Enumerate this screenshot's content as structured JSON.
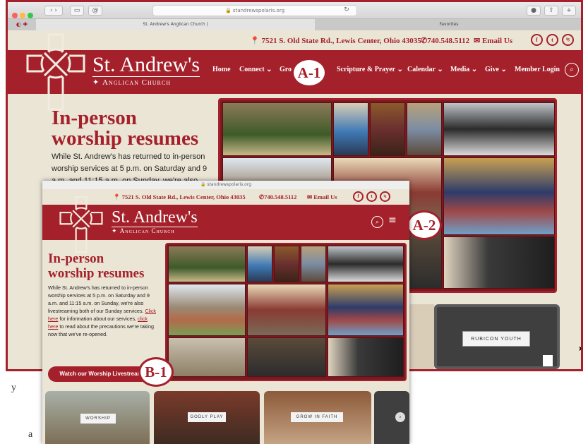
{
  "browser": {
    "url": "standrewspolaris.org",
    "tabs": [
      "St. Andrew's Anglican Church |",
      "Favorites"
    ]
  },
  "topbar": {
    "address": "7521 S. Old State Rd., Lewis Center, Ohio 43035",
    "phone": "740.548.5112",
    "email": "Email Us",
    "social": [
      "f",
      "t",
      "ig"
    ]
  },
  "brand": {
    "name": "St. Andrew's",
    "sub": "Anglican Church"
  },
  "nav": [
    "Home",
    "Connect",
    "Gro",
    "Scripture & Prayer",
    "Calendar",
    "Media",
    "Give",
    "Member Login"
  ],
  "hero": {
    "title_1": "In-person",
    "title_2": "worship resumes",
    "body_desktop_1": "While St. Andrew's has returned to in-person",
    "body_desktop_2": "worship services at 5 p.m. on Saturday and 9",
    "body_desktop_3": "a.m. and 11:15 a.m. on Sunday, we're also"
  },
  "mobile": {
    "url": "standrewspolaris.org",
    "address": "7521 S. Old State Rd., Lewis Center, Ohio 43035",
    "phone": "740.548.5112",
    "email": "Email Us",
    "body_1": "While St. Andrew's has returned to in-person",
    "body_2": "worship services at 5 p.m. on Saturday and 9",
    "body_3": "a.m. and 11:15 a.m. on Sunday, we're also",
    "body_4a": "livestreaming both of our Sunday services.",
    "body_4b": "Click",
    "body_5a": "here",
    "body_5b": " for information about our services, ",
    "body_5c": "click",
    "body_6a": "here",
    "body_6b": " to read about the precautions we're taking",
    "body_7": "now that we've re-opened.",
    "button": "Watch our Worship Livestream",
    "cards": [
      "WORSHIP",
      "GODLY PLAY",
      "GROW IN FAITH"
    ]
  },
  "rubicon": "RUBICON YOUTH",
  "callouts": {
    "a1": "A-1",
    "a2": "A-2",
    "b1": "B-1"
  },
  "stray": [
    "y",
    "a"
  ],
  "colors": {
    "brand": "#a4202a",
    "cream": "#ebe5d6"
  }
}
